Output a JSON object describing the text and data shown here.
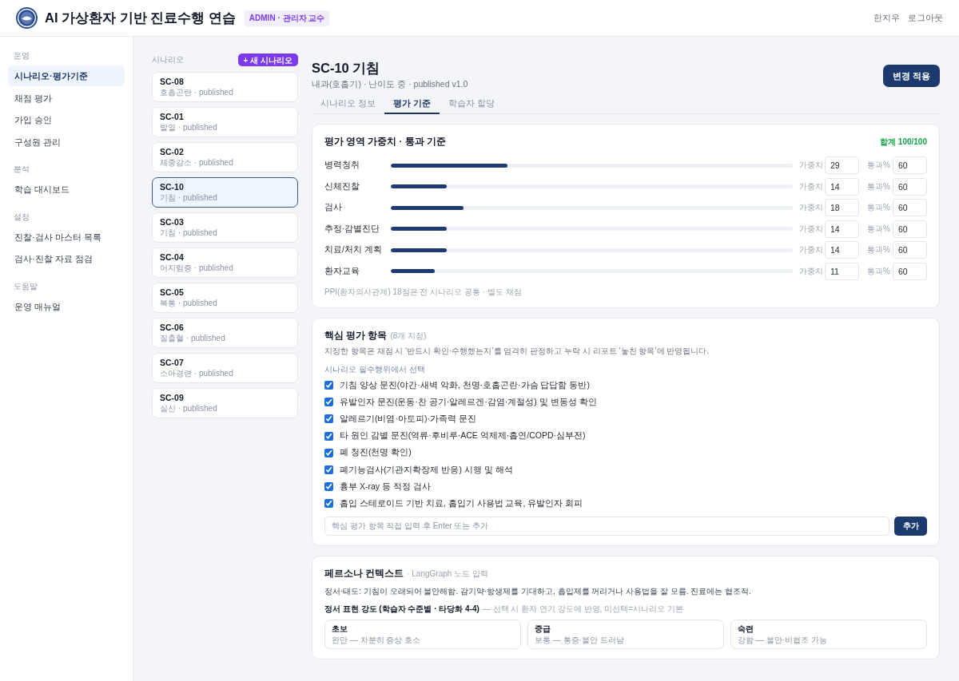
{
  "header": {
    "title": "AI 가상환자 기반 진료수행 연습",
    "badge": "ADMIN · 관리자 교수",
    "user": "한지우",
    "logout": "로그아웃"
  },
  "sidebar": {
    "sections": [
      {
        "label": "운영",
        "items": [
          {
            "label": "시나리오·평가기준",
            "selected": true
          },
          {
            "label": "채점 평가",
            "selected": false
          },
          {
            "label": "가입 승인",
            "selected": false
          },
          {
            "label": "구성원 관리",
            "selected": false
          }
        ]
      },
      {
        "label": "분석",
        "items": [
          {
            "label": "학습 대시보드",
            "selected": false
          }
        ]
      },
      {
        "label": "설정",
        "items": [
          {
            "label": "진찰·검사 마스터 목록",
            "selected": false
          },
          {
            "label": "검사·진찰 자료 점검",
            "selected": false
          }
        ]
      },
      {
        "label": "도움말",
        "items": [
          {
            "label": "운영 매뉴얼",
            "selected": false
          }
        ]
      }
    ]
  },
  "scenarios": {
    "label": "시나리오",
    "new_button": "+ 새 시나리오",
    "items": [
      {
        "code": "SC-08",
        "subtitle": "호흡곤란 · published",
        "selected": false
      },
      {
        "code": "SC-01",
        "subtitle": "발열 · published",
        "selected": false
      },
      {
        "code": "SC-02",
        "subtitle": "체중감소 · published",
        "selected": false
      },
      {
        "code": "SC-10",
        "subtitle": "기침 · published",
        "selected": true
      },
      {
        "code": "SC-03",
        "subtitle": "기침 · published",
        "selected": false
      },
      {
        "code": "SC-04",
        "subtitle": "어지럼증 · published",
        "selected": false
      },
      {
        "code": "SC-05",
        "subtitle": "복통 · published",
        "selected": false
      },
      {
        "code": "SC-06",
        "subtitle": "질출혈 · published",
        "selected": false
      },
      {
        "code": "SC-07",
        "subtitle": "소아경련 · published",
        "selected": false
      },
      {
        "code": "SC-09",
        "subtitle": "실신 · published",
        "selected": false
      }
    ]
  },
  "detail": {
    "title": "SC-10 기침",
    "meta": "내과(호흡기) · 난이도 중 · published v1.0",
    "apply_button": "변경 적용"
  },
  "tabs": [
    {
      "label": "시나리오 정보",
      "selected": false
    },
    {
      "label": "평가 기준",
      "selected": true
    },
    {
      "label": "학습자 할당",
      "selected": false
    }
  ],
  "weights": {
    "title": "평가 영역 가중치 · 통과 기준",
    "total": "합계 100/100",
    "rows": [
      {
        "name": "병력청취",
        "level": 0.29,
        "weight_label": "가중치",
        "weight": "29",
        "pass_label": "통과%",
        "pass": "60"
      },
      {
        "name": "신체진찰",
        "level": 0.14,
        "weight_label": "가중치",
        "weight": "14",
        "pass_label": "통과%",
        "pass": "60"
      },
      {
        "name": "검사",
        "level": 0.18,
        "weight_label": "가중치",
        "weight": "18",
        "pass_label": "통과%",
        "pass": "60"
      },
      {
        "name": "추정·감별진단",
        "level": 0.14,
        "weight_label": "가중치",
        "weight": "14",
        "pass_label": "통과%",
        "pass": "60"
      },
      {
        "name": "치료/처치 계획",
        "level": 0.14,
        "weight_label": "가중치",
        "weight": "14",
        "pass_label": "통과%",
        "pass": "60"
      },
      {
        "name": "환자교육",
        "level": 0.11,
        "weight_label": "가중치",
        "weight": "11",
        "pass_label": "통과%",
        "pass": "60"
      }
    ],
    "note": "PPI(환자의사관계) 18점은 전 시나리오 공통 · 별도 채점"
  },
  "core_items": {
    "title": "핵심 평가 항목",
    "count": "(8개 지정)",
    "description": "지정한 항목은 채점 시 ‘반드시 확인·수행했는지’를 엄격히 판정하고 누락 시 리포트 ‘놓친 항목’에 반영됩니다.",
    "source_label": "시나리오 필수행위에서 선택",
    "items": [
      {
        "label": "기침 양상 문진(야간·새벽 악화, 천명·호흡곤란·가슴 답답함 동반)",
        "checked": true
      },
      {
        "label": "유발인자 문진(운동·찬 공기·알레르겐·감염·계절성) 및 변동성 확인",
        "checked": true
      },
      {
        "label": "알레르기(비염·아토피)·가족력 문진",
        "checked": true
      },
      {
        "label": "타 원인 감별 문진(역류·후비루·ACE 억제제·흡연/COPD·심부전)",
        "checked": true
      },
      {
        "label": "폐 청진(천명 확인)",
        "checked": true
      },
      {
        "label": "폐기능검사(기관지확장제 반응) 시행 및 해석",
        "checked": true
      },
      {
        "label": "흉부 X-ray 등 적정 검사",
        "checked": true
      },
      {
        "label": "흡입 스테로이드 기반 치료, 흡입기 사용법 교육, 유발인자 회피",
        "checked": true
      }
    ],
    "input": {
      "placeholder": "핵심 평가 항목 직접 입력 후 Enter 또는 추가"
    },
    "add_button": "추가"
  },
  "persona": {
    "title": "페르소나 컨텍스트",
    "subtitle": "· LangGraph 노드 입력",
    "text": "정서·태도: 기침이 오래되어 불안해함. 감기약·항생제를 기대하고, 흡입제를 꺼리거나 사용법을 잘 모름. 진료에는 협조적.",
    "intensity_title": "정서 표현 강도 (학습자 수준별 · 타당화 4-4)",
    "intensity_note": "— 선택 시 환자 연기 강도에 반영, 미선택=시나리오 기본",
    "levels": [
      {
        "label": "초보",
        "description": "완만 — 차분히 증상 호소",
        "selected": false
      },
      {
        "label": "중급",
        "description": "보통 — 통증·불안 드러남",
        "selected": false
      },
      {
        "label": "숙련",
        "description": "강함 — 불안·비협조 가능",
        "selected": false
      }
    ]
  }
}
